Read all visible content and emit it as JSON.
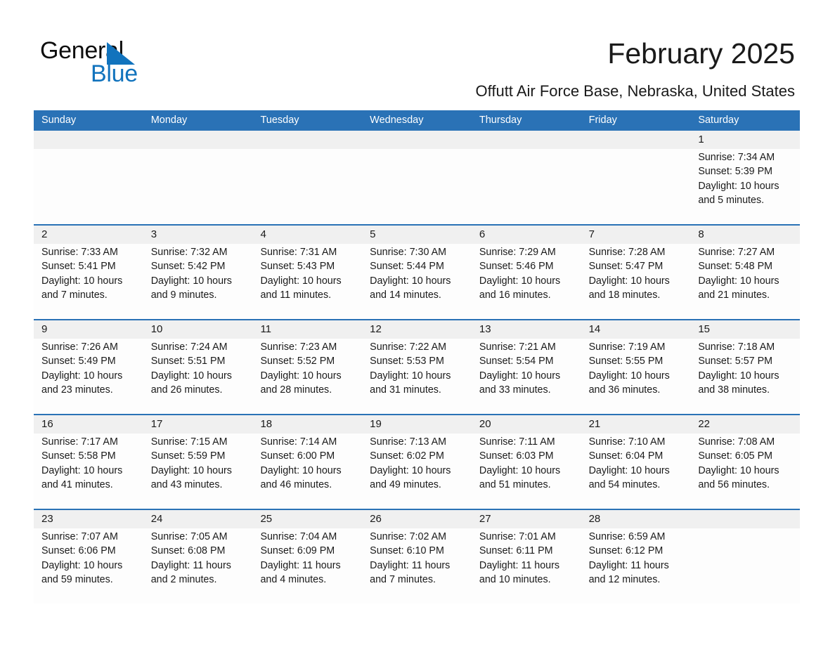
{
  "brand": {
    "name_part1": "General",
    "name_part2": "Blue",
    "triangle_icon": "triangle-icon",
    "accent_color": "#1173bd"
  },
  "header": {
    "title": "February 2025",
    "subtitle": "Offutt Air Force Base, Nebraska, United States"
  },
  "theme": {
    "header_blue": "#2a72b6",
    "band_gray": "#f0f0f0",
    "cell_white": "#fdfdfd",
    "text_color": "#1a1a1a"
  },
  "weekdays": [
    "Sunday",
    "Monday",
    "Tuesday",
    "Wednesday",
    "Thursday",
    "Friday",
    "Saturday"
  ],
  "weeks": [
    [
      {
        "day": "",
        "sunrise": "",
        "sunset": "",
        "daylight_line1": "",
        "daylight_line2": ""
      },
      {
        "day": "",
        "sunrise": "",
        "sunset": "",
        "daylight_line1": "",
        "daylight_line2": ""
      },
      {
        "day": "",
        "sunrise": "",
        "sunset": "",
        "daylight_line1": "",
        "daylight_line2": ""
      },
      {
        "day": "",
        "sunrise": "",
        "sunset": "",
        "daylight_line1": "",
        "daylight_line2": ""
      },
      {
        "day": "",
        "sunrise": "",
        "sunset": "",
        "daylight_line1": "",
        "daylight_line2": ""
      },
      {
        "day": "",
        "sunrise": "",
        "sunset": "",
        "daylight_line1": "",
        "daylight_line2": ""
      },
      {
        "day": "1",
        "sunrise": "Sunrise: 7:34 AM",
        "sunset": "Sunset: 5:39 PM",
        "daylight_line1": "Daylight: 10 hours",
        "daylight_line2": "and 5 minutes."
      }
    ],
    [
      {
        "day": "2",
        "sunrise": "Sunrise: 7:33 AM",
        "sunset": "Sunset: 5:41 PM",
        "daylight_line1": "Daylight: 10 hours",
        "daylight_line2": "and 7 minutes."
      },
      {
        "day": "3",
        "sunrise": "Sunrise: 7:32 AM",
        "sunset": "Sunset: 5:42 PM",
        "daylight_line1": "Daylight: 10 hours",
        "daylight_line2": "and 9 minutes."
      },
      {
        "day": "4",
        "sunrise": "Sunrise: 7:31 AM",
        "sunset": "Sunset: 5:43 PM",
        "daylight_line1": "Daylight: 10 hours",
        "daylight_line2": "and 11 minutes."
      },
      {
        "day": "5",
        "sunrise": "Sunrise: 7:30 AM",
        "sunset": "Sunset: 5:44 PM",
        "daylight_line1": "Daylight: 10 hours",
        "daylight_line2": "and 14 minutes."
      },
      {
        "day": "6",
        "sunrise": "Sunrise: 7:29 AM",
        "sunset": "Sunset: 5:46 PM",
        "daylight_line1": "Daylight: 10 hours",
        "daylight_line2": "and 16 minutes."
      },
      {
        "day": "7",
        "sunrise": "Sunrise: 7:28 AM",
        "sunset": "Sunset: 5:47 PM",
        "daylight_line1": "Daylight: 10 hours",
        "daylight_line2": "and 18 minutes."
      },
      {
        "day": "8",
        "sunrise": "Sunrise: 7:27 AM",
        "sunset": "Sunset: 5:48 PM",
        "daylight_line1": "Daylight: 10 hours",
        "daylight_line2": "and 21 minutes."
      }
    ],
    [
      {
        "day": "9",
        "sunrise": "Sunrise: 7:26 AM",
        "sunset": "Sunset: 5:49 PM",
        "daylight_line1": "Daylight: 10 hours",
        "daylight_line2": "and 23 minutes."
      },
      {
        "day": "10",
        "sunrise": "Sunrise: 7:24 AM",
        "sunset": "Sunset: 5:51 PM",
        "daylight_line1": "Daylight: 10 hours",
        "daylight_line2": "and 26 minutes."
      },
      {
        "day": "11",
        "sunrise": "Sunrise: 7:23 AM",
        "sunset": "Sunset: 5:52 PM",
        "daylight_line1": "Daylight: 10 hours",
        "daylight_line2": "and 28 minutes."
      },
      {
        "day": "12",
        "sunrise": "Sunrise: 7:22 AM",
        "sunset": "Sunset: 5:53 PM",
        "daylight_line1": "Daylight: 10 hours",
        "daylight_line2": "and 31 minutes."
      },
      {
        "day": "13",
        "sunrise": "Sunrise: 7:21 AM",
        "sunset": "Sunset: 5:54 PM",
        "daylight_line1": "Daylight: 10 hours",
        "daylight_line2": "and 33 minutes."
      },
      {
        "day": "14",
        "sunrise": "Sunrise: 7:19 AM",
        "sunset": "Sunset: 5:55 PM",
        "daylight_line1": "Daylight: 10 hours",
        "daylight_line2": "and 36 minutes."
      },
      {
        "day": "15",
        "sunrise": "Sunrise: 7:18 AM",
        "sunset": "Sunset: 5:57 PM",
        "daylight_line1": "Daylight: 10 hours",
        "daylight_line2": "and 38 minutes."
      }
    ],
    [
      {
        "day": "16",
        "sunrise": "Sunrise: 7:17 AM",
        "sunset": "Sunset: 5:58 PM",
        "daylight_line1": "Daylight: 10 hours",
        "daylight_line2": "and 41 minutes."
      },
      {
        "day": "17",
        "sunrise": "Sunrise: 7:15 AM",
        "sunset": "Sunset: 5:59 PM",
        "daylight_line1": "Daylight: 10 hours",
        "daylight_line2": "and 43 minutes."
      },
      {
        "day": "18",
        "sunrise": "Sunrise: 7:14 AM",
        "sunset": "Sunset: 6:00 PM",
        "daylight_line1": "Daylight: 10 hours",
        "daylight_line2": "and 46 minutes."
      },
      {
        "day": "19",
        "sunrise": "Sunrise: 7:13 AM",
        "sunset": "Sunset: 6:02 PM",
        "daylight_line1": "Daylight: 10 hours",
        "daylight_line2": "and 49 minutes."
      },
      {
        "day": "20",
        "sunrise": "Sunrise: 7:11 AM",
        "sunset": "Sunset: 6:03 PM",
        "daylight_line1": "Daylight: 10 hours",
        "daylight_line2": "and 51 minutes."
      },
      {
        "day": "21",
        "sunrise": "Sunrise: 7:10 AM",
        "sunset": "Sunset: 6:04 PM",
        "daylight_line1": "Daylight: 10 hours",
        "daylight_line2": "and 54 minutes."
      },
      {
        "day": "22",
        "sunrise": "Sunrise: 7:08 AM",
        "sunset": "Sunset: 6:05 PM",
        "daylight_line1": "Daylight: 10 hours",
        "daylight_line2": "and 56 minutes."
      }
    ],
    [
      {
        "day": "23",
        "sunrise": "Sunrise: 7:07 AM",
        "sunset": "Sunset: 6:06 PM",
        "daylight_line1": "Daylight: 10 hours",
        "daylight_line2": "and 59 minutes."
      },
      {
        "day": "24",
        "sunrise": "Sunrise: 7:05 AM",
        "sunset": "Sunset: 6:08 PM",
        "daylight_line1": "Daylight: 11 hours",
        "daylight_line2": "and 2 minutes."
      },
      {
        "day": "25",
        "sunrise": "Sunrise: 7:04 AM",
        "sunset": "Sunset: 6:09 PM",
        "daylight_line1": "Daylight: 11 hours",
        "daylight_line2": "and 4 minutes."
      },
      {
        "day": "26",
        "sunrise": "Sunrise: 7:02 AM",
        "sunset": "Sunset: 6:10 PM",
        "daylight_line1": "Daylight: 11 hours",
        "daylight_line2": "and 7 minutes."
      },
      {
        "day": "27",
        "sunrise": "Sunrise: 7:01 AM",
        "sunset": "Sunset: 6:11 PM",
        "daylight_line1": "Daylight: 11 hours",
        "daylight_line2": "and 10 minutes."
      },
      {
        "day": "28",
        "sunrise": "Sunrise: 6:59 AM",
        "sunset": "Sunset: 6:12 PM",
        "daylight_line1": "Daylight: 11 hours",
        "daylight_line2": "and 12 minutes."
      },
      {
        "day": "",
        "sunrise": "",
        "sunset": "",
        "daylight_line1": "",
        "daylight_line2": ""
      }
    ]
  ]
}
